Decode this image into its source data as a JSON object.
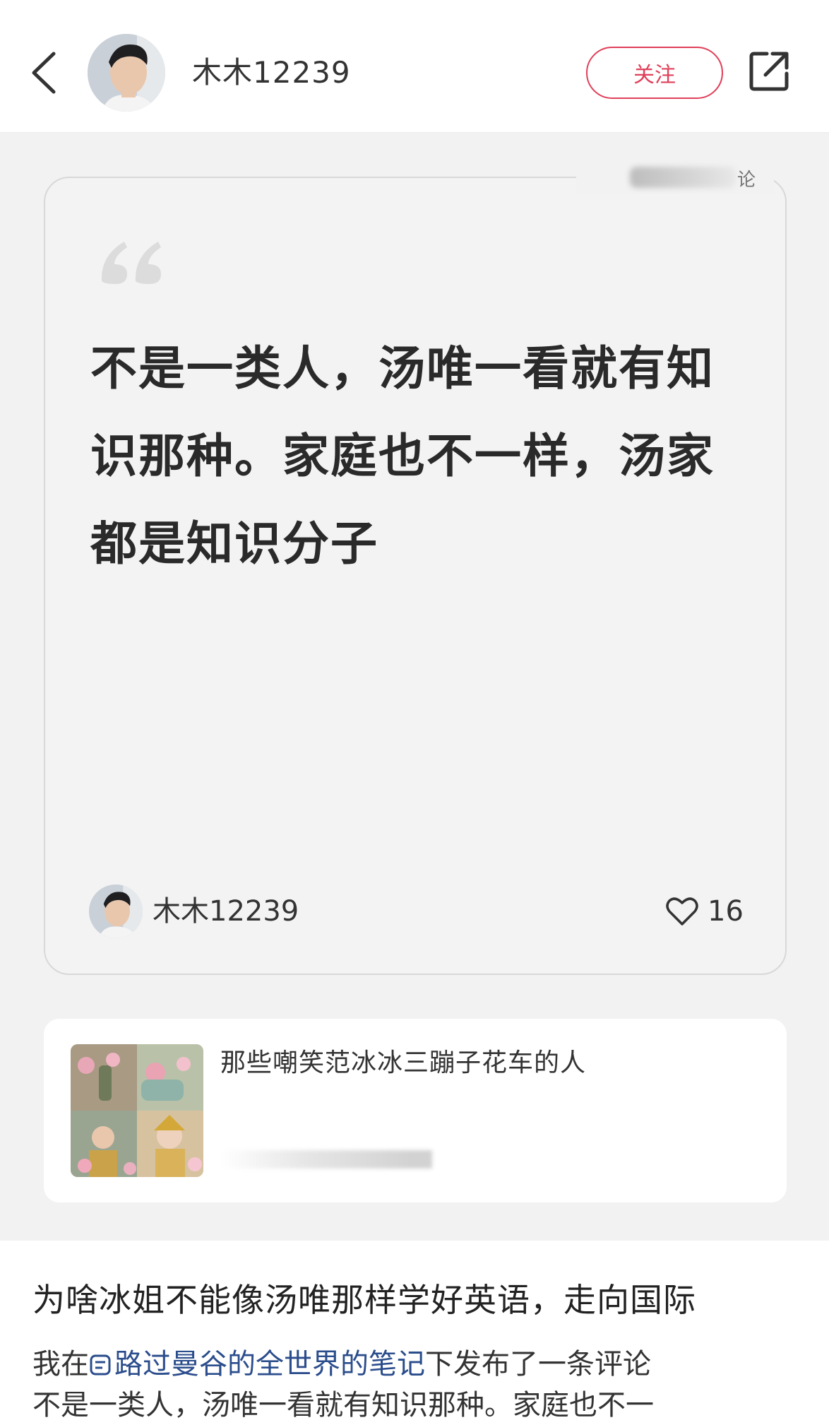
{
  "header": {
    "username": "木木12239",
    "follow_label": "关注"
  },
  "quote_card": {
    "tag_suffix": "论",
    "quote_text": "不是一类人，汤唯一看就有知识那种。家庭也不一样，汤家都是知识分子",
    "author_name": "木木12239",
    "like_count": "16"
  },
  "note_card": {
    "title": "那些嘲笑范冰冰三蹦子花车的人"
  },
  "post": {
    "title": "为啥冰姐不能像汤唯那样学好英语，走向国际",
    "meta_prefix": "我在",
    "meta_link": "路过曼谷的全世界的笔记",
    "meta_suffix": "下发布了一条评论",
    "body_preview": "不是一类人，汤唯一看就有知识那种。家庭也不一"
  },
  "colors": {
    "accent": "#e0405a",
    "link": "#2b4d8c",
    "content_bg": "#f2f2f2"
  },
  "icons": {
    "back": "chevron-left-icon",
    "share": "share-icon",
    "quote": "quote-mark-icon",
    "like": "heart-icon",
    "note": "note-icon"
  }
}
